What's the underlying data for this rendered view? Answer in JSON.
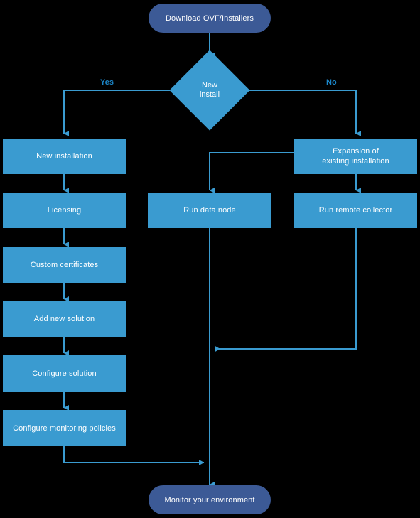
{
  "diagram": {
    "title": "Download OVF/Installers",
    "background_color": "#000000",
    "process_color": "#3a9bd0",
    "terminator_color": "#3c5a96",
    "connector_color": "#3a9bd0",
    "label_color": "#1b86c8",
    "text_color": "#ffffff"
  },
  "nodes": {
    "start": {
      "label": "Download OVF/Installers",
      "shape": "terminator"
    },
    "decision": {
      "label": "New\ninstall",
      "line1": "New",
      "line2": "install",
      "shape": "diamond"
    },
    "new_installation": {
      "label": "New installation",
      "shape": "process"
    },
    "licensing": {
      "label": "Licensing",
      "shape": "process"
    },
    "custom_certificates": {
      "label": "Custom certificates",
      "shape": "process"
    },
    "add_new_solution": {
      "label": "Add new solution",
      "shape": "process"
    },
    "configure_solution": {
      "label": "Configure solution",
      "shape": "process"
    },
    "configure_monitoring_policies": {
      "label": "Configure monitoring policies",
      "shape": "process"
    },
    "run_data_node": {
      "label": "Run data node",
      "shape": "process"
    },
    "expansion": {
      "line1": "Expansion of",
      "line2": "existing installation",
      "label": "Expansion of existing installation",
      "shape": "process"
    },
    "run_remote_collector": {
      "label": "Run remote collector",
      "shape": "process"
    },
    "end": {
      "label": "Monitor your environment",
      "shape": "terminator"
    }
  },
  "edge_labels": {
    "yes": "Yes",
    "no": "No"
  }
}
